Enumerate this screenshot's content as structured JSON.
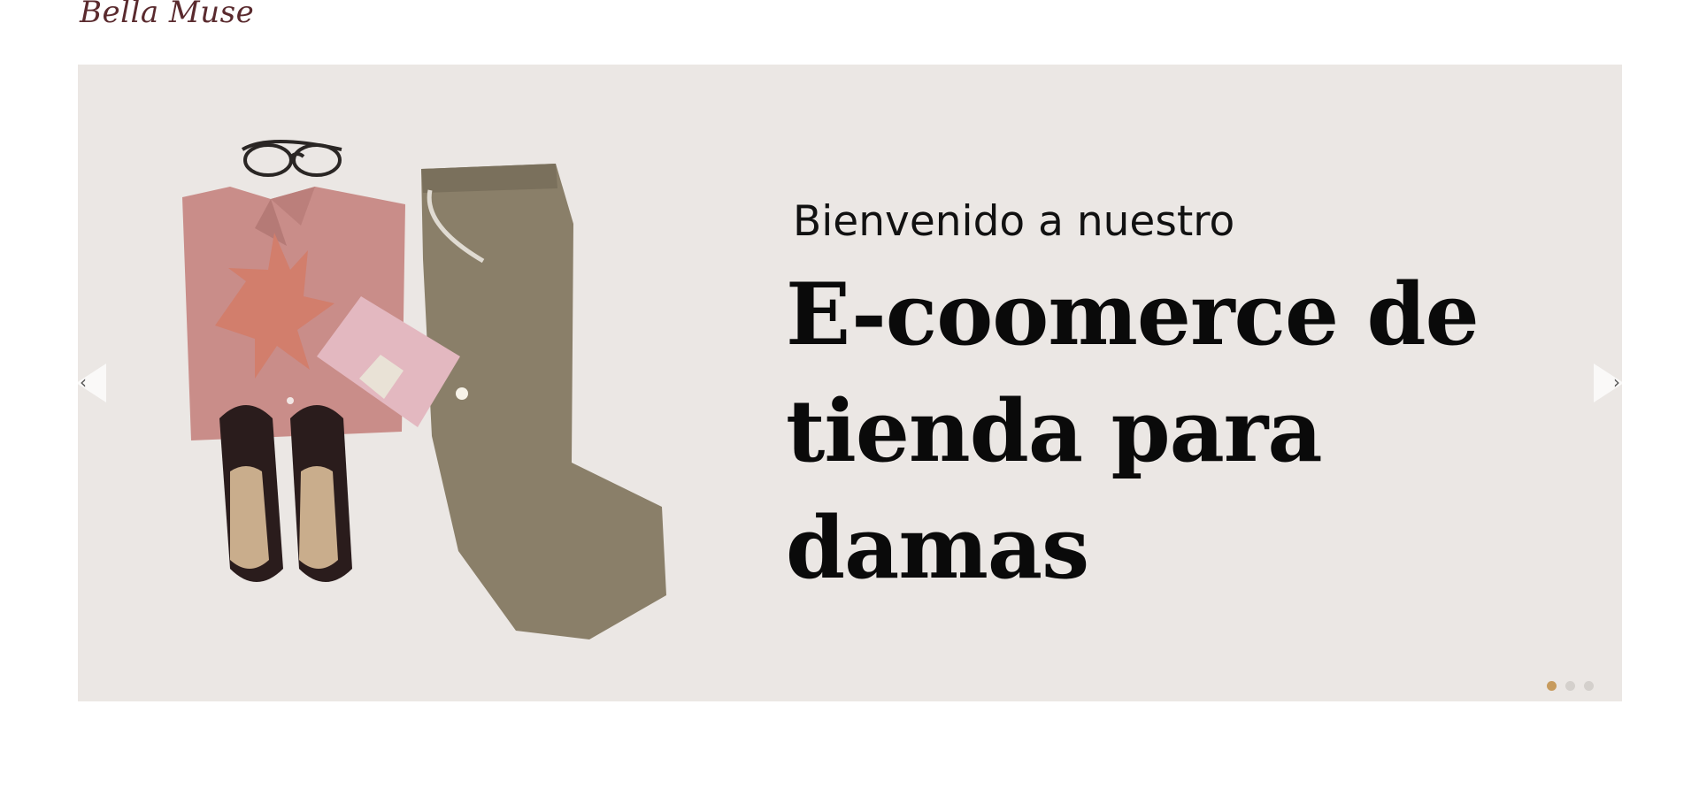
{
  "header": {
    "logo_text": "Bella Muse"
  },
  "hero": {
    "subtitle": "Bienvenido a nuestro",
    "title_line_1": "E-coomerce de",
    "title_line_2": "tienda para",
    "title_line_3": "damas",
    "prev_arrow": "‹",
    "next_arrow": "›",
    "slide_count": 3,
    "active_slide": 1
  },
  "colors": {
    "hero_background": "#ebe7e4",
    "logo": "#5a2a2e",
    "active_dot": "#c79b5e",
    "inactive_dot": "#d4d0cc"
  },
  "icons": {
    "prev": "chevron-left-icon",
    "next": "chevron-right-icon"
  }
}
